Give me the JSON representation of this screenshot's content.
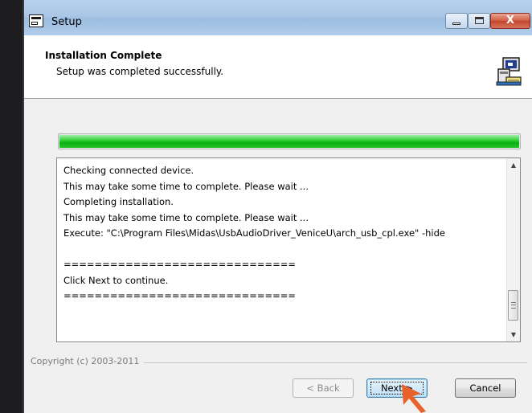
{
  "window": {
    "title": "Setup",
    "buttons": {
      "minimize_icon": "minimize-icon",
      "maximize_icon": "maximize-icon",
      "close_glyph": "X"
    }
  },
  "header": {
    "title": "Installation Complete",
    "subtitle": "Setup was completed successfully.",
    "icon": "installer-computer-icon"
  },
  "progress": {
    "value": 1.0,
    "color": "#16c11b"
  },
  "log": {
    "lines": [
      "Checking connected device.",
      "This may take some time to complete. Please wait ...",
      "Completing installation.",
      "This may take some time to complete. Please wait ...",
      "Execute: \"C:\\Program Files\\Midas\\UsbAudioDriver_VeniceU\\arch_usb_cpl.exe\" -hide",
      "",
      "==============================",
      "Click Next to continue.",
      "=============================="
    ]
  },
  "footer": {
    "copyright": "Copyright (c) 2003-2011",
    "back_label": "< Back",
    "next_label": "Next >",
    "cancel_label": "Cancel"
  },
  "colors": {
    "title_bar": "#a9c6e6",
    "accent_cursor": "#e8632b"
  }
}
